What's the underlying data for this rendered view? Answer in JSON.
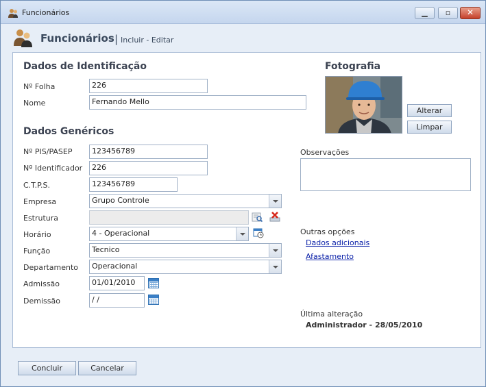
{
  "window": {
    "title": "Funcionários"
  },
  "header": {
    "title": "Funcionários",
    "separator": "|",
    "subtitle": "Incluir - Editar"
  },
  "identification": {
    "section_title": "Dados de Identificação",
    "folha_label": "Nº Folha",
    "folha_value": "226",
    "nome_label": "Nome",
    "nome_value": "Fernando Mello"
  },
  "photo": {
    "section_title": "Fotografia",
    "change_label": "Alterar",
    "clear_label": "Limpar"
  },
  "generic": {
    "section_title": "Dados Genéricos",
    "pis_label": "Nº PIS/PASEP",
    "pis_value": "123456789",
    "identificador_label": "Nº Identificador",
    "identificador_value": "226",
    "ctps_label": "C.T.P.S.",
    "ctps_value": "123456789",
    "empresa_label": "Empresa",
    "empresa_value": "Grupo Controle",
    "estrutura_label": "Estrutura",
    "estrutura_value": "",
    "horario_label": "Horário",
    "horario_value": "4 - Operacional",
    "funcao_label": "Função",
    "funcao_value": "Tecnico",
    "departamento_label": "Departamento",
    "departamento_value": "Operacional",
    "admissao_label": "Admissão",
    "admissao_value": "01/01/2010",
    "demissao_label": "Demissão",
    "demissao_value": " /  /"
  },
  "sidebar": {
    "observacoes_label": "Observações",
    "outras_opcoes_label": "Outras opções",
    "link_dados_adicionais": "Dados adicionais",
    "link_afastamento": "Afastamento",
    "ultima_alteracao_label": "Última alteração",
    "ultima_alteracao_value": "Administrador - 28/05/2010"
  },
  "footer": {
    "concluir_label": "Concluir",
    "cancelar_label": "Cancelar"
  },
  "colors": {
    "accent_link": "#0a20a8",
    "close_button": "#c5402a",
    "panel_border": "#a9bcd6"
  },
  "icons": [
    "app-people-icon",
    "minimize-icon",
    "maximize-icon",
    "close-icon",
    "people-icon",
    "search-structure-icon",
    "delete-structure-icon",
    "schedule-icon",
    "calendar-icon"
  ]
}
